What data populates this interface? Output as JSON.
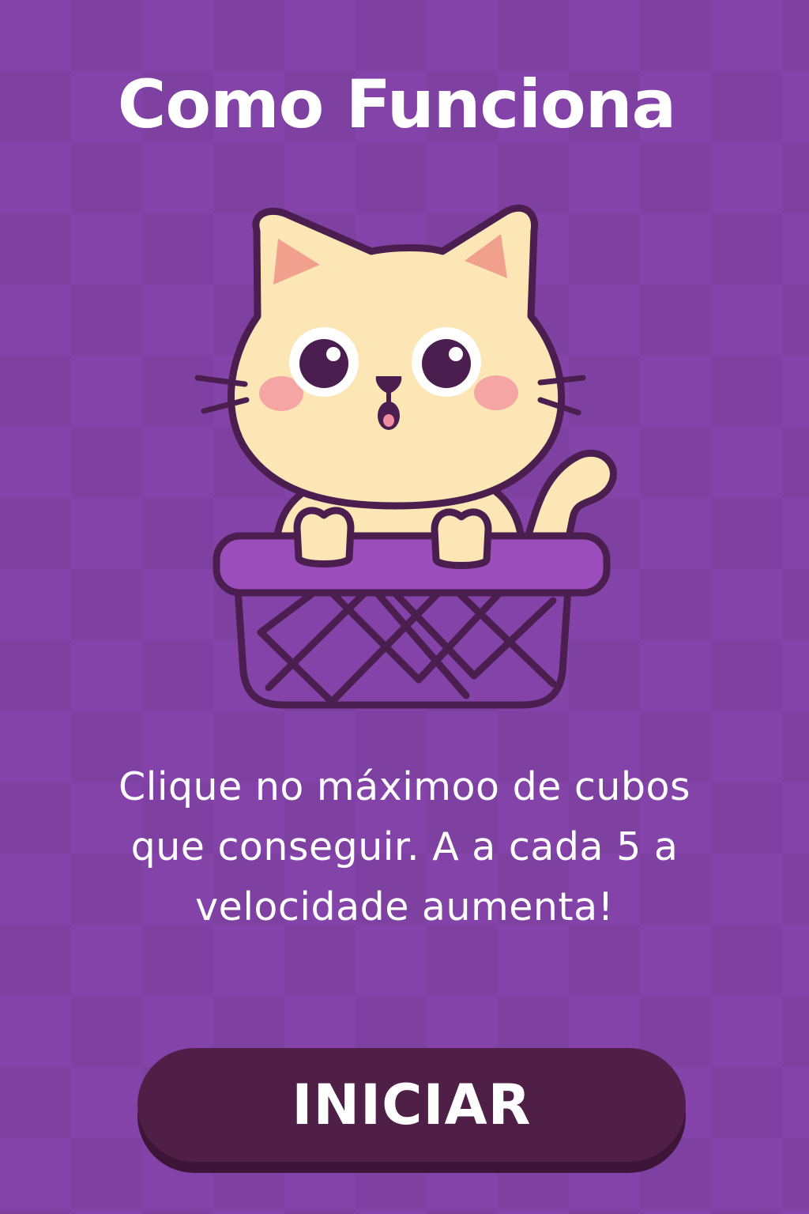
{
  "screen": {
    "title": "Como Funciona",
    "instructions": "Clique no máximoo de cubos que conseguir. A a cada 5 a velocidade aumenta!",
    "start_label": "INICIAR"
  },
  "illustration": {
    "subject": "cat-in-basket"
  },
  "colors": {
    "background": "#8443a8",
    "button": "#4f1f47",
    "cat_fur": "#fde6b5",
    "outline": "#4a1f4f",
    "basket_rim": "#9c4dbc",
    "text": "#ffffff"
  }
}
